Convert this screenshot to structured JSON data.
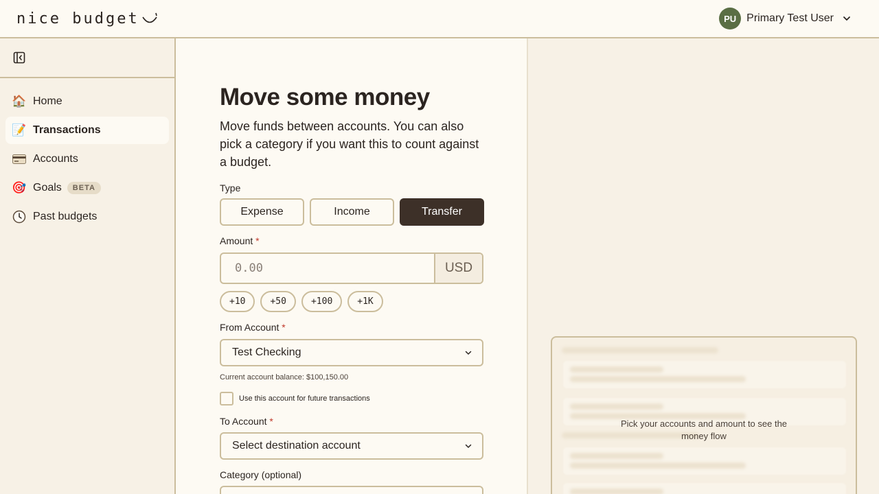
{
  "app": {
    "logo_text": "nice budget",
    "user": {
      "initials": "PU",
      "name": "Primary Test User"
    }
  },
  "colors": {
    "accent_dark": "#3d3028",
    "avatar_bg": "#5a6e44",
    "border": "#cbbd9c",
    "required": "#c0392b"
  },
  "sidebar": {
    "items": [
      {
        "label": "Home",
        "icon": "house-icon"
      },
      {
        "label": "Transactions",
        "icon": "memo-icon",
        "active": true
      },
      {
        "label": "Accounts",
        "icon": "credit-card-icon"
      },
      {
        "label": "Goals",
        "icon": "target-icon",
        "badge": "BETA"
      },
      {
        "label": "Past budgets",
        "icon": "clock-icon"
      }
    ]
  },
  "form": {
    "title": "Move some money",
    "description": "Move funds between accounts. You can also pick a category if you want this to count against a budget.",
    "type_label": "Type",
    "types": [
      "Expense",
      "Income",
      "Transfer"
    ],
    "selected_type": "Transfer",
    "amount_label": "Amount",
    "required_mark": "*",
    "amount_placeholder": "0.00",
    "currency": "USD",
    "quick_amounts": [
      "+10",
      "+50",
      "+100",
      "+1K"
    ],
    "from_label": "From Account",
    "from_value": "Test Checking",
    "balance_hint": "Current account balance: $100,150.00",
    "remember_label": "Use this account for future transactions",
    "to_label": "To Account",
    "to_placeholder": "Select destination account",
    "category_label": "Category (optional)"
  },
  "preview": {
    "message_line1": "Pick your accounts and amount to see the",
    "message_line2": "money flow"
  }
}
